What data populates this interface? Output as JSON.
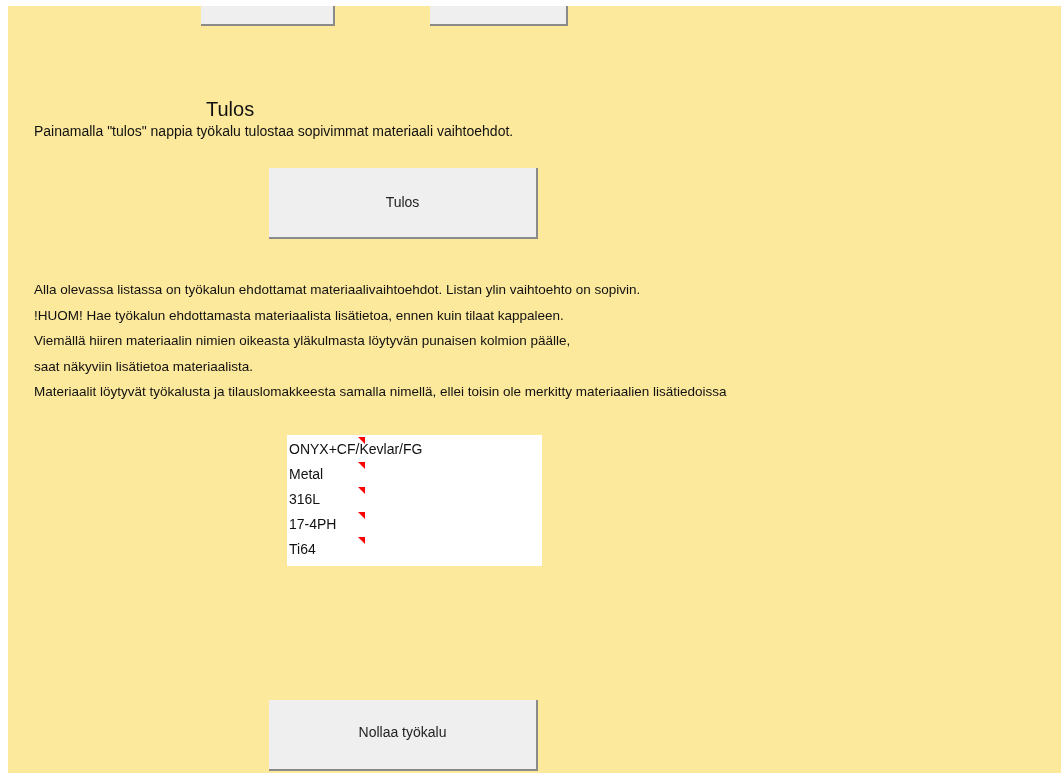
{
  "heading": "Tulos",
  "intro": "Painamalla \"tulos\" nappia työkalu tulostaa sopivimmat materiaali vaihtoehdot.",
  "result_button": "Tulos",
  "instructions": [
    "Alla olevassa listassa on työkalun ehdottamat materiaalivaihtoehdot. Listan ylin vaihtoehto on sopivin.",
    "!HUOM! Hae työkalun ehdottamasta materiaalista lisätietoa, ennen kuin tilaat kappaleen.",
    "Viemällä hiiren materiaalin nimien oikeasta yläkulmasta löytyvän punaisen kolmion päälle,",
    "saat näkyviin lisätietoa materiaalista.",
    "Materiaalit löytyvät työkalusta ja tilauslomakkeesta samalla nimellä, ellei toisin ole merkitty materiaalien lisätiedoissa"
  ],
  "materials": [
    {
      "name": "ONYX+CF/Kevlar/FG",
      "has_comment": true
    },
    {
      "name": "Metal",
      "has_comment": true
    },
    {
      "name": "316L",
      "has_comment": true
    },
    {
      "name": "17-4PH",
      "has_comment": true
    },
    {
      "name": "Ti64",
      "has_comment": true
    }
  ],
  "reset_button": "Nollaa työkalu"
}
